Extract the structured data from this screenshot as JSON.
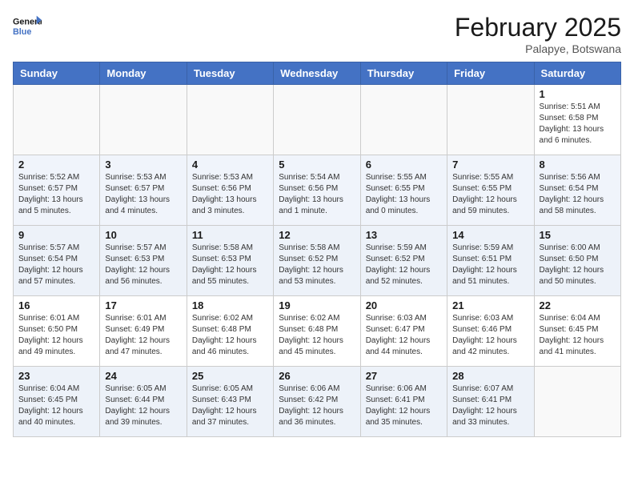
{
  "header": {
    "logo_general": "General",
    "logo_blue": "Blue",
    "month_title": "February 2025",
    "location": "Palapye, Botswana"
  },
  "weekdays": [
    "Sunday",
    "Monday",
    "Tuesday",
    "Wednesday",
    "Thursday",
    "Friday",
    "Saturday"
  ],
  "weeks": [
    [
      {
        "day": "",
        "info": ""
      },
      {
        "day": "",
        "info": ""
      },
      {
        "day": "",
        "info": ""
      },
      {
        "day": "",
        "info": ""
      },
      {
        "day": "",
        "info": ""
      },
      {
        "day": "",
        "info": ""
      },
      {
        "day": "1",
        "info": "Sunrise: 5:51 AM\nSunset: 6:58 PM\nDaylight: 13 hours\nand 6 minutes."
      }
    ],
    [
      {
        "day": "2",
        "info": "Sunrise: 5:52 AM\nSunset: 6:57 PM\nDaylight: 13 hours\nand 5 minutes."
      },
      {
        "day": "3",
        "info": "Sunrise: 5:53 AM\nSunset: 6:57 PM\nDaylight: 13 hours\nand 4 minutes."
      },
      {
        "day": "4",
        "info": "Sunrise: 5:53 AM\nSunset: 6:56 PM\nDaylight: 13 hours\nand 3 minutes."
      },
      {
        "day": "5",
        "info": "Sunrise: 5:54 AM\nSunset: 6:56 PM\nDaylight: 13 hours\nand 1 minute."
      },
      {
        "day": "6",
        "info": "Sunrise: 5:55 AM\nSunset: 6:55 PM\nDaylight: 13 hours\nand 0 minutes."
      },
      {
        "day": "7",
        "info": "Sunrise: 5:55 AM\nSunset: 6:55 PM\nDaylight: 12 hours\nand 59 minutes."
      },
      {
        "day": "8",
        "info": "Sunrise: 5:56 AM\nSunset: 6:54 PM\nDaylight: 12 hours\nand 58 minutes."
      }
    ],
    [
      {
        "day": "9",
        "info": "Sunrise: 5:57 AM\nSunset: 6:54 PM\nDaylight: 12 hours\nand 57 minutes."
      },
      {
        "day": "10",
        "info": "Sunrise: 5:57 AM\nSunset: 6:53 PM\nDaylight: 12 hours\nand 56 minutes."
      },
      {
        "day": "11",
        "info": "Sunrise: 5:58 AM\nSunset: 6:53 PM\nDaylight: 12 hours\nand 55 minutes."
      },
      {
        "day": "12",
        "info": "Sunrise: 5:58 AM\nSunset: 6:52 PM\nDaylight: 12 hours\nand 53 minutes."
      },
      {
        "day": "13",
        "info": "Sunrise: 5:59 AM\nSunset: 6:52 PM\nDaylight: 12 hours\nand 52 minutes."
      },
      {
        "day": "14",
        "info": "Sunrise: 5:59 AM\nSunset: 6:51 PM\nDaylight: 12 hours\nand 51 minutes."
      },
      {
        "day": "15",
        "info": "Sunrise: 6:00 AM\nSunset: 6:50 PM\nDaylight: 12 hours\nand 50 minutes."
      }
    ],
    [
      {
        "day": "16",
        "info": "Sunrise: 6:01 AM\nSunset: 6:50 PM\nDaylight: 12 hours\nand 49 minutes."
      },
      {
        "day": "17",
        "info": "Sunrise: 6:01 AM\nSunset: 6:49 PM\nDaylight: 12 hours\nand 47 minutes."
      },
      {
        "day": "18",
        "info": "Sunrise: 6:02 AM\nSunset: 6:48 PM\nDaylight: 12 hours\nand 46 minutes."
      },
      {
        "day": "19",
        "info": "Sunrise: 6:02 AM\nSunset: 6:48 PM\nDaylight: 12 hours\nand 45 minutes."
      },
      {
        "day": "20",
        "info": "Sunrise: 6:03 AM\nSunset: 6:47 PM\nDaylight: 12 hours\nand 44 minutes."
      },
      {
        "day": "21",
        "info": "Sunrise: 6:03 AM\nSunset: 6:46 PM\nDaylight: 12 hours\nand 42 minutes."
      },
      {
        "day": "22",
        "info": "Sunrise: 6:04 AM\nSunset: 6:45 PM\nDaylight: 12 hours\nand 41 minutes."
      }
    ],
    [
      {
        "day": "23",
        "info": "Sunrise: 6:04 AM\nSunset: 6:45 PM\nDaylight: 12 hours\nand 40 minutes."
      },
      {
        "day": "24",
        "info": "Sunrise: 6:05 AM\nSunset: 6:44 PM\nDaylight: 12 hours\nand 39 minutes."
      },
      {
        "day": "25",
        "info": "Sunrise: 6:05 AM\nSunset: 6:43 PM\nDaylight: 12 hours\nand 37 minutes."
      },
      {
        "day": "26",
        "info": "Sunrise: 6:06 AM\nSunset: 6:42 PM\nDaylight: 12 hours\nand 36 minutes."
      },
      {
        "day": "27",
        "info": "Sunrise: 6:06 AM\nSunset: 6:41 PM\nDaylight: 12 hours\nand 35 minutes."
      },
      {
        "day": "28",
        "info": "Sunrise: 6:07 AM\nSunset: 6:41 PM\nDaylight: 12 hours\nand 33 minutes."
      },
      {
        "day": "",
        "info": ""
      }
    ]
  ]
}
